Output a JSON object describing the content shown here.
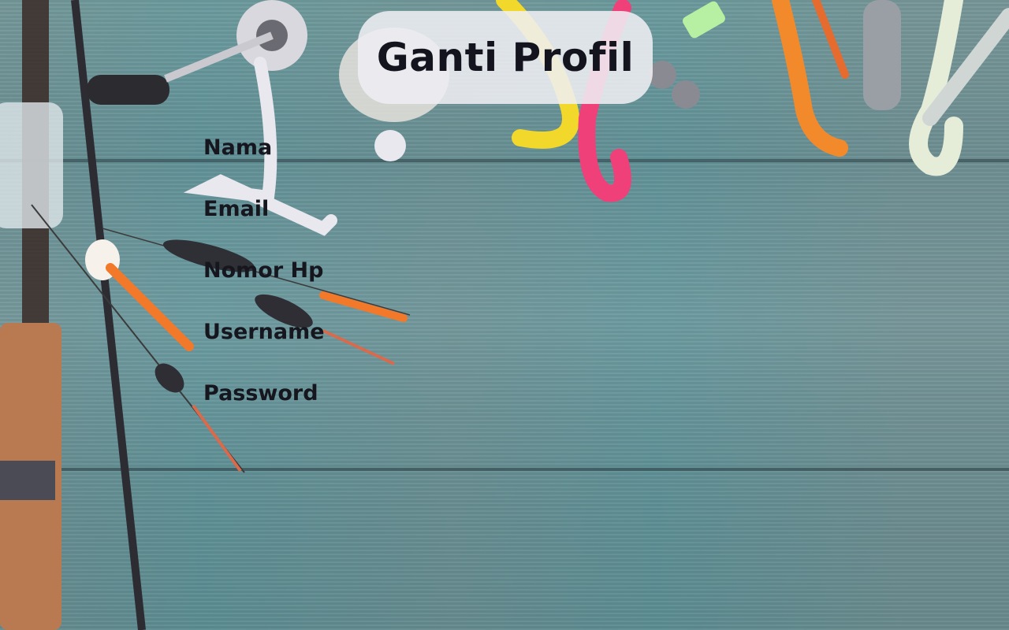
{
  "page": {
    "title": "Ganti Profil"
  },
  "form": {
    "fields": [
      {
        "label": "Nama"
      },
      {
        "label": "Email"
      },
      {
        "label": "Nomor Hp"
      },
      {
        "label": "Username"
      },
      {
        "label": "Password"
      }
    ]
  },
  "theme": {
    "background_color": "#5b8d92",
    "title_pill_color": "#eeeef2",
    "text_color": "#16161e"
  }
}
